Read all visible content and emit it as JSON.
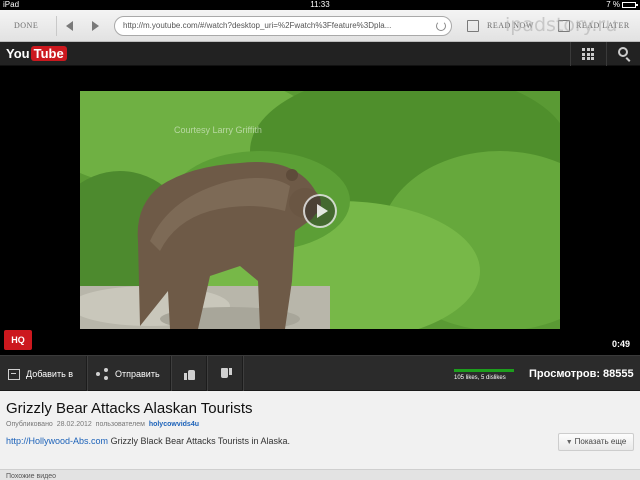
{
  "statusbar": {
    "device": "iPad",
    "time": "11:33",
    "battery": "7 %"
  },
  "browser": {
    "done_label": "DONE",
    "url": "http://m.youtube.com/#/watch?desktop_uri=%2Fwatch%3Ffeature%3Dpla...",
    "read_now_label": "READ NOW",
    "read_later_label": "READ LATER",
    "watermark": "ipadstory.ru"
  },
  "youtube": {
    "logo_you": "You",
    "logo_tube": "Tube"
  },
  "player": {
    "caption": "Courtesy Larry Griffith",
    "hq_label": "HQ",
    "duration": "0:49"
  },
  "actions": {
    "add_to_label": "Добавить в",
    "share_label": "Отправить",
    "ratings_text": "105 likes, 5 dislikes",
    "views_text": "Просмотров: 88555"
  },
  "video": {
    "title": "Grizzly Bear Attacks Alaskan Tourists",
    "published_label": "Опубликовано",
    "published_date": "28.02.2012",
    "by_label": "пользователем",
    "author": "holycowvids4u",
    "desc_link": "http://Hollywood-Abs.com",
    "desc_text": "Grizzly Black Bear Attacks Tourists in Alaska.",
    "show_more_label": "Показать еще"
  },
  "related": {
    "title": "Похожие видео"
  },
  "colors": {
    "youtube_red": "#cc181e",
    "link_blue": "#1c62b9",
    "like_green": "#1d9e1d"
  }
}
